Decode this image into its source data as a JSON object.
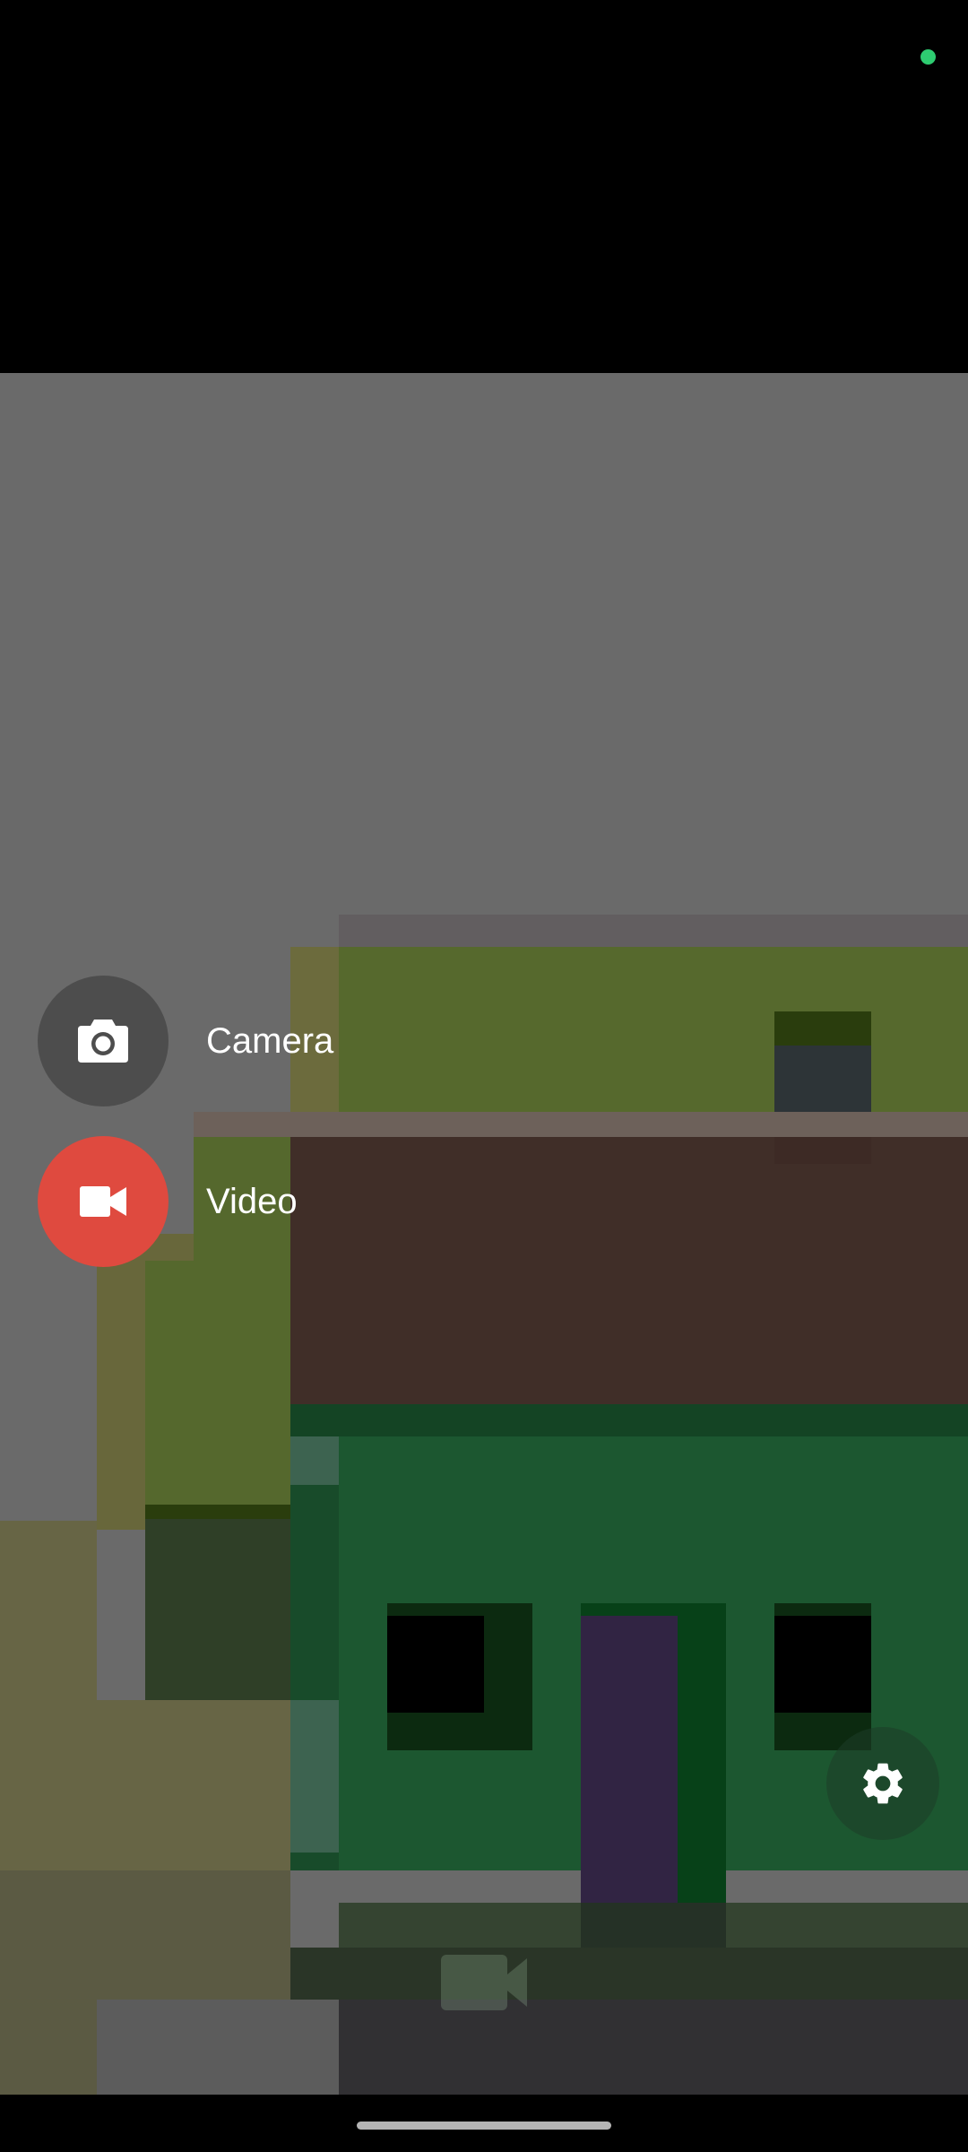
{
  "actions": {
    "camera": {
      "label": "Camera",
      "icon": "camera-icon"
    },
    "video": {
      "label": "Video",
      "icon": "videocam-icon"
    }
  },
  "controls": {
    "settings_icon": "gear-icon",
    "record_icon": "videocam-icon"
  },
  "colors": {
    "privacy_indicator": "#2ecc71",
    "video_fab": "#df4a3f",
    "camera_fab": "#4d4d4d"
  }
}
